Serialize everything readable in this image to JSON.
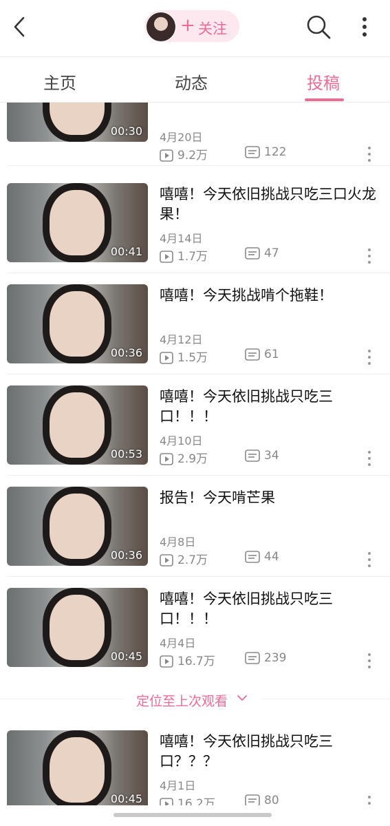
{
  "header": {
    "follow_label": "关注",
    "plus_symbol": "+",
    "accent_color": "#f06b93"
  },
  "tabs": [
    {
      "label": "主页",
      "active": false
    },
    {
      "label": "动态",
      "active": false
    },
    {
      "label": "投稿",
      "active": true
    }
  ],
  "videos": [
    {
      "title": "",
      "date": "4月20日",
      "plays": "9.2万",
      "comments": "122",
      "duration": "00:30"
    },
    {
      "title": "嘻嘻！今天依旧挑战只吃三口火龙果！",
      "date": "4月14日",
      "plays": "1.7万",
      "comments": "47",
      "duration": "00:41"
    },
    {
      "title": "嘻嘻！今天挑战啃个拖鞋！",
      "date": "4月12日",
      "plays": "1.5万",
      "comments": "61",
      "duration": "00:36"
    },
    {
      "title": "嘻嘻！今天依旧挑战只吃三口！！！",
      "date": "4月10日",
      "plays": "2.9万",
      "comments": "34",
      "duration": "00:53"
    },
    {
      "title": "报告！今天啃芒果",
      "date": "4月8日",
      "plays": "2.7万",
      "comments": "44",
      "duration": "00:36"
    },
    {
      "title": "嘻嘻！今天依旧挑战只吃三口！！！",
      "date": "4月4日",
      "plays": "16.7万",
      "comments": "239",
      "duration": "00:45"
    },
    {
      "title": "嘻嘻！今天依旧挑战只吃三口？？？",
      "date": "4月1日",
      "plays": "16.2万",
      "comments": "80",
      "duration": "00:45"
    }
  ],
  "locate_last_viewed": "定位至上次观看"
}
